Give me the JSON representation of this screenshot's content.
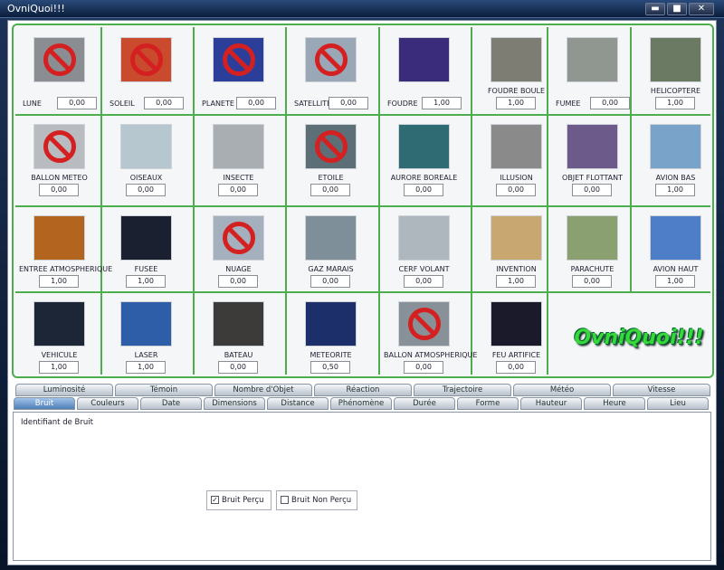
{
  "window": {
    "title": "OvniQuoi!!!",
    "min": "▬",
    "max": "■",
    "close": "✕"
  },
  "cells": [
    {
      "label": "LUNE",
      "value": "0,00",
      "kind": "no",
      "bg": "#8a8e92",
      "inline": true
    },
    {
      "label": "SOLEIL",
      "value": "0,00",
      "kind": "no",
      "bg": "#c94a2c",
      "inline": true
    },
    {
      "label": "PLANETE",
      "value": "0,00",
      "kind": "no",
      "bg": "#2b3f9a",
      "inline": true
    },
    {
      "label": "SATELLITE",
      "value": "0,00",
      "kind": "no",
      "bg": "#9aa7b6",
      "inline": true
    },
    {
      "label": "FOUDRE",
      "value": "1,00",
      "kind": "img",
      "bg": "#3a2c7a",
      "inline": true
    },
    {
      "label": "FOUDRE BOULE",
      "value": "1,00",
      "kind": "img",
      "bg": "#7e7d74",
      "inline": false
    },
    {
      "label": "FUMEE",
      "value": "0,00",
      "kind": "img",
      "bg": "#8f9790",
      "inline": true
    },
    {
      "label": "HELICOPTERE",
      "value": "1,00",
      "kind": "img",
      "bg": "#6b7a62",
      "inline": false
    },
    {
      "label": "BALLON METEO",
      "value": "0,00",
      "kind": "no",
      "bg": "#b8bcc0",
      "inline": false
    },
    {
      "label": "OISEAUX",
      "value": "0,00",
      "kind": "img",
      "bg": "#b7c7cf",
      "inline": false
    },
    {
      "label": "INSECTE",
      "value": "0,00",
      "kind": "img",
      "bg": "#a8aeb2",
      "inline": false
    },
    {
      "label": "ETOILE",
      "value": "0,00",
      "kind": "no",
      "bg": "#5c6e76",
      "inline": false
    },
    {
      "label": "AURORE BOREALE",
      "value": "0,00",
      "kind": "img",
      "bg": "#2f6b72",
      "inline": false
    },
    {
      "label": "ILLUSION",
      "value": "0,00",
      "kind": "img",
      "bg": "#8a8a8a",
      "inline": false
    },
    {
      "label": "OBJET FLOTTANT",
      "value": "0,00",
      "kind": "img",
      "bg": "#6b5a8a",
      "inline": false
    },
    {
      "label": "AVION BAS",
      "value": "1,00",
      "kind": "img",
      "bg": "#7aa3c9",
      "inline": false
    },
    {
      "label": "ENTREE ATMOSPHERIQUE",
      "value": "1,00",
      "kind": "img",
      "bg": "#b3651f",
      "inline": false
    },
    {
      "label": "FUSEE",
      "value": "1,00",
      "kind": "img",
      "bg": "#1a2030",
      "inline": false
    },
    {
      "label": "NUAGE",
      "value": "0,00",
      "kind": "no",
      "bg": "#a4b0bd",
      "inline": false
    },
    {
      "label": "GAZ MARAIS",
      "value": "0,00",
      "kind": "img",
      "bg": "#7f8f9a",
      "inline": false
    },
    {
      "label": "CERF VOLANT",
      "value": "0,00",
      "kind": "img",
      "bg": "#aeb6be",
      "inline": false
    },
    {
      "label": "INVENTION",
      "value": "1,00",
      "kind": "img",
      "bg": "#c9a770",
      "inline": false
    },
    {
      "label": "PARACHUTE",
      "value": "0,00",
      "kind": "img",
      "bg": "#8aa070",
      "inline": false
    },
    {
      "label": "AVION HAUT",
      "value": "1,00",
      "kind": "img",
      "bg": "#4f7ec9",
      "inline": false
    },
    {
      "label": "VEHICULE",
      "value": "1,00",
      "kind": "img",
      "bg": "#1c2636",
      "inline": false
    },
    {
      "label": "LASER",
      "value": "1,00",
      "kind": "img",
      "bg": "#2f5ea9",
      "inline": false
    },
    {
      "label": "BATEAU",
      "value": "0,00",
      "kind": "img",
      "bg": "#3c3b3a",
      "inline": false
    },
    {
      "label": "METEORITE",
      "value": "0,50",
      "kind": "img",
      "bg": "#1d2f6a",
      "inline": false
    },
    {
      "label": "BALLON ATMOSPHERIQUE",
      "value": "0,00",
      "kind": "no",
      "bg": "#889098",
      "inline": false
    },
    {
      "label": "FEU ARTIFICE",
      "value": "0,00",
      "kind": "img",
      "bg": "#1a1a2a",
      "inline": false
    }
  ],
  "logo": "OvniQuoi!!!",
  "tabs_row1": [
    "Luminosité",
    "Témoin",
    "Nombre d'Objet",
    "Réaction",
    "Trajectoire",
    "Météo",
    "Vitesse"
  ],
  "tabs_row2": [
    "Bruit",
    "Couleurs",
    "Date",
    "Dimensions",
    "Distance",
    "Phénomène",
    "Durée",
    "Forme",
    "Hauteur",
    "Heure",
    "Lieu"
  ],
  "panel": {
    "label": "Identifiant de Bruit",
    "check1": "Bruit Perçu",
    "check1_checked": "✓",
    "check2": "Bruit Non Perçu"
  }
}
